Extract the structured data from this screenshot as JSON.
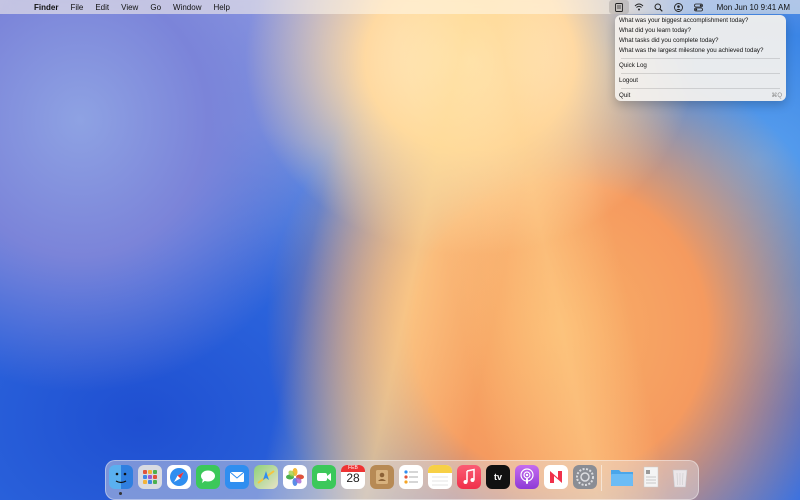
{
  "menubar": {
    "apple_glyph": "",
    "app_name": "Finder",
    "menus": [
      "File",
      "Edit",
      "View",
      "Go",
      "Window",
      "Help"
    ],
    "datetime": "Mon Jun 10  9:41 AM",
    "status_icons": [
      "log-app-icon",
      "wifi-icon",
      "search-icon",
      "user-icon",
      "control-center-icon"
    ]
  },
  "panel": {
    "prompts": [
      "What was your biggest accomplishment today?",
      "What did you learn today?",
      "What tasks did you complete today?",
      "What was the largest milestone you achieved today?"
    ],
    "quick_log": "Quick Log",
    "logout": "Logout",
    "quit": "Quit",
    "quit_shortcut": "⌘Q"
  },
  "dock": {
    "calendar_month": "FEB",
    "calendar_day": "28",
    "tv_label": "tv",
    "apps": [
      "Finder",
      "Launchpad",
      "Safari",
      "Messages",
      "Mail",
      "Maps",
      "Photos",
      "FaceTime",
      "Calendar",
      "Contacts",
      "Reminders",
      "Notes",
      "Music",
      "TV",
      "Podcasts",
      "News",
      "System Settings",
      "Downloads",
      "Document",
      "Trash"
    ]
  }
}
